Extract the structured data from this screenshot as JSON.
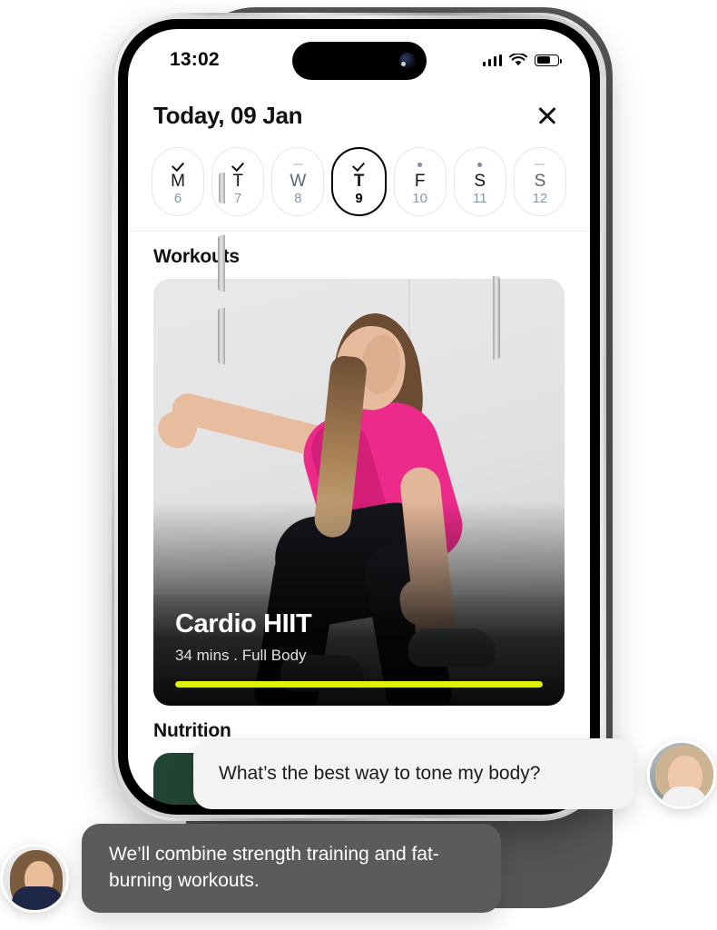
{
  "status_bar": {
    "time": "13:02",
    "cellular_icon": "cellular-bars-icon",
    "wifi_icon": "wifi-icon",
    "battery_icon": "battery-icon",
    "battery_level": 58
  },
  "header": {
    "title": "Today, 09 Jan",
    "close_icon": "close-icon"
  },
  "day_selector": {
    "days": [
      {
        "dow": "M",
        "dom": "6",
        "mark": "check",
        "selected": false
      },
      {
        "dow": "T",
        "dom": "7",
        "mark": "check",
        "selected": false
      },
      {
        "dow": "W",
        "dom": "8",
        "mark": "dash",
        "selected": false
      },
      {
        "dow": "T",
        "dom": "9",
        "mark": "check",
        "selected": true
      },
      {
        "dow": "F",
        "dom": "10",
        "mark": "dot",
        "selected": false
      },
      {
        "dow": "S",
        "dom": "11",
        "mark": "dot",
        "selected": false
      },
      {
        "dow": "S",
        "dom": "12",
        "mark": "dash",
        "selected": false
      }
    ]
  },
  "sections": {
    "workouts_title": "Workouts",
    "nutrition_title": "Nutrition"
  },
  "workout_card": {
    "title": "Cardio HIIT",
    "duration": "34 mins",
    "separator": ".",
    "body_focus": "Full Body",
    "meta": "34 mins  .  Full Body",
    "progress_percent": 100,
    "progress_color": "#dff200"
  },
  "chat": {
    "messages": [
      {
        "author": "user",
        "text": "What’s the best way to tone my body?",
        "bubble_color": "#f3f3f3",
        "text_color": "#1c1c1c",
        "avatar": "user-avatar"
      },
      {
        "author": "coach",
        "text": "We’ll combine strength training and fat-burning workouts.",
        "bubble_color": "#5b5b5b",
        "text_color": "#ffffff",
        "avatar": "coach-avatar"
      }
    ]
  },
  "theme": {
    "accent": "#dff200",
    "background": "#ffffff",
    "backdrop": "#555555",
    "muted_text": "#8b97ab"
  }
}
